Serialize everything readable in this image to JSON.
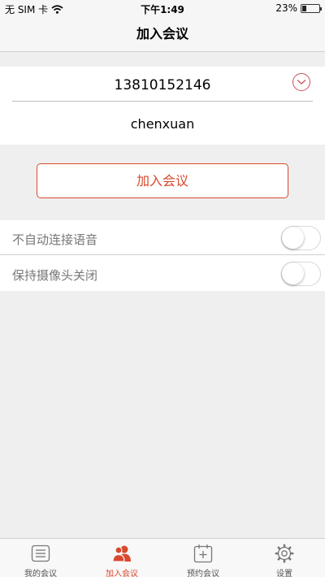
{
  "status_bar": {
    "carrier": "无 SIM 卡",
    "time": "下午1:49",
    "battery_percent": "23%",
    "battery_level": 0.23
  },
  "header": {
    "title": "加入会议"
  },
  "form": {
    "meeting_number": "13810152146",
    "display_name": "chenxuan"
  },
  "join_button_label": "加入会议",
  "options": [
    {
      "label": "不自动连接语音",
      "on": false
    },
    {
      "label": "保持摄像头关闭",
      "on": false
    }
  ],
  "tabs": [
    {
      "label": "我的会议",
      "icon": "list-icon"
    },
    {
      "label": "加入会议",
      "icon": "people-icon",
      "active": true
    },
    {
      "label": "预约会议",
      "icon": "calendar-plus-icon"
    },
    {
      "label": "设置",
      "icon": "gear-icon"
    }
  ],
  "colors": {
    "accent": "#d9492d",
    "dropdown": "#c8505a",
    "background": "#efefef"
  }
}
